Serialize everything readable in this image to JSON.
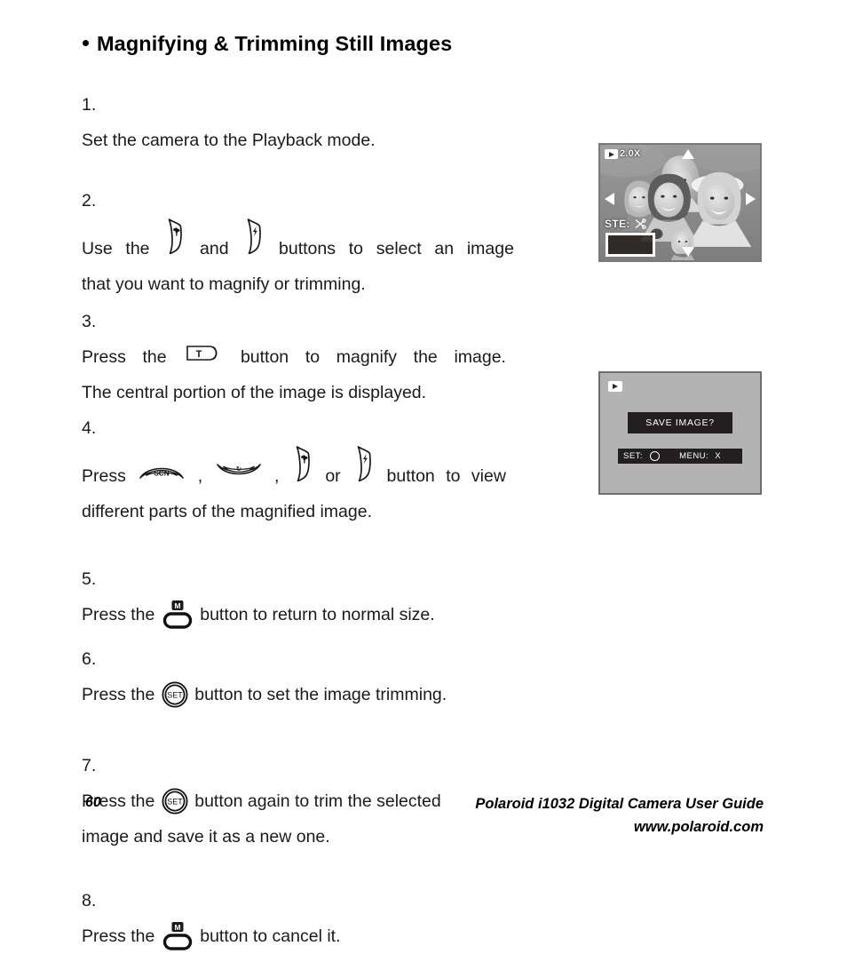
{
  "page": {
    "heading": "Magnifying & Trimming Still Images",
    "page_number": "60"
  },
  "steps": [
    {
      "num": "1.",
      "lines": [
        "Set the camera to the Playback mode."
      ]
    },
    {
      "num": "2.",
      "line1_parts": [
        "Use",
        "the",
        "[macro-button]",
        "and",
        "[flash-button]",
        "buttons",
        "to",
        "select",
        "an",
        "image"
      ],
      "line2": "that you want to magnify or trimming."
    },
    {
      "num": "3.",
      "line1_parts": [
        "Press",
        "the",
        "[T-button]",
        "button",
        "to",
        "magnify",
        "the",
        "image."
      ],
      "line2": "The central portion of the image is displayed."
    },
    {
      "num": "4.",
      "line1_parts": [
        "Press",
        "[scn-button]",
        ",",
        "[timer-button]",
        ",",
        "[macro-button]",
        "or",
        "[flash-button]",
        "button",
        "to",
        "view"
      ],
      "line2": "different parts of the magnified image."
    },
    {
      "num": "5.",
      "line1_parts": [
        "Press the",
        "[menu-button]",
        "button to return to normal size."
      ]
    },
    {
      "num": "6.",
      "line1_parts": [
        "Press the",
        "[set-button]",
        "button to set the image trimming."
      ]
    },
    {
      "num": "7.",
      "line1_parts": [
        "Press the",
        "[set-button]",
        "button again to trim the selected"
      ],
      "line2": "image and save it as a new one."
    },
    {
      "num": "8.",
      "line1_parts": [
        "Press the",
        "[menu-button]",
        "button to cancel it."
      ]
    }
  ],
  "step_text": {
    "s1_l1": "Set the camera to the Playback mode.",
    "s2_use": "Use",
    "s2_the": "the",
    "s2_and": "and",
    "s2_buttons": "buttons",
    "s2_to": "to",
    "s2_select": "select",
    "s2_an": "an",
    "s2_image": "image",
    "s2_l2": "that you want to magnify or trimming.",
    "s3_press": "Press",
    "s3_the": "the",
    "s3_button": "button",
    "s3_to": "to",
    "s3_magnify": "magnify",
    "s3_the2": "the",
    "s3_image": "image.",
    "s3_l2": "The central portion of the image is displayed.",
    "s4_press": "Press",
    "s4_comma1": ",",
    "s4_comma2": ",",
    "s4_or": "or",
    "s4_button": "button",
    "s4_to": "to",
    "s4_view": "view",
    "s4_l2": "different parts of the magnified image.",
    "s5_pre": "Press the",
    "s5_post": "button to return to normal size.",
    "s6_pre": "Press the",
    "s6_post": "button to set the image trimming.",
    "s7_pre": "Press the",
    "s7_post": "button again to trim the selected",
    "s7_l2": "image and save it as a new one.",
    "s8_pre": "Press the",
    "s8_post": "button to cancel it."
  },
  "numbers": {
    "n1": "1.",
    "n2": "2.",
    "n3": "3.",
    "n4": "4.",
    "n5": "5.",
    "n6": "6.",
    "n7": "7.",
    "n8": "8."
  },
  "icons": {
    "macro_button": "macro-flower-button-icon",
    "flash_button": "flash-button-icon",
    "scn_button": "scene-mode-button-icon",
    "timer_button": "self-timer-button-icon",
    "t_button_label": "T",
    "menu_button_label": "M",
    "set_button_label": "SET",
    "playback_icon": "playback-mode-icon",
    "scissors_icon": "scissors-icon"
  },
  "lcd_photo": {
    "zoom_level": "2.0X",
    "ste_label": "STE:",
    "arrows": [
      "up",
      "down",
      "left",
      "right"
    ]
  },
  "lcd_dialog": {
    "prompt": "SAVE IMAGE?",
    "set_label": "SET:",
    "set_glyph": "○",
    "menu_label": "MENU:",
    "menu_glyph": "X"
  },
  "footer": {
    "page_number": "60",
    "guide_title": "Polaroid i1032 Digital Camera User Guide",
    "website": "www.polaroid.com"
  },
  "colors": {
    "text": "#000000",
    "lcd_background": "#b3b3b3",
    "lcd_border": "#6e6e6e",
    "osd_dark": "#231f20",
    "osd_light": "#ffffff"
  }
}
